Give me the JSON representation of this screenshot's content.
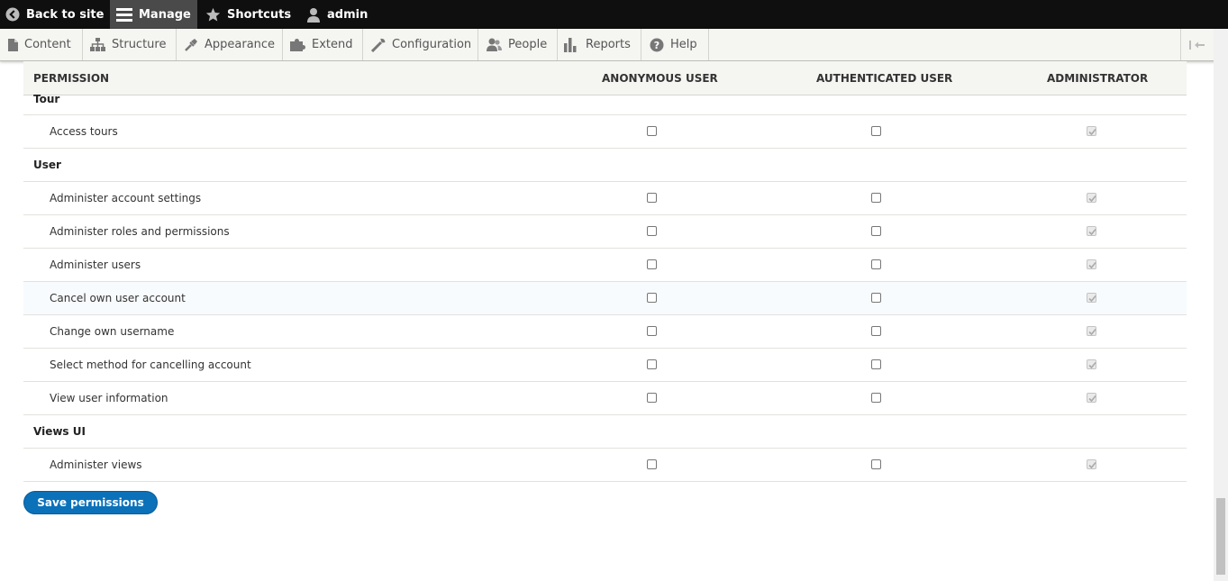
{
  "toolbar": {
    "back": "Back to site",
    "manage": "Manage",
    "shortcuts": "Shortcuts",
    "user": "admin"
  },
  "tray": {
    "items": [
      "Content",
      "Structure",
      "Appearance",
      "Extend",
      "Configuration",
      "People",
      "Reports",
      "Help"
    ]
  },
  "table": {
    "headers": {
      "permission": "PERMISSION",
      "anonymous": "ANONYMOUS USER",
      "authenticated": "AUTHENTICATED USER",
      "administrator": "ADMINISTRATOR"
    },
    "rows": [
      {
        "type": "module",
        "label": "Tour"
      },
      {
        "type": "perm",
        "label": "Access tours",
        "anonymous": false,
        "authenticated": false,
        "administrator": true
      },
      {
        "type": "module",
        "label": "User"
      },
      {
        "type": "perm",
        "label": "Administer account settings",
        "anonymous": false,
        "authenticated": false,
        "administrator": true
      },
      {
        "type": "perm",
        "label": "Administer roles and permissions",
        "anonymous": false,
        "authenticated": false,
        "administrator": true
      },
      {
        "type": "perm",
        "label": "Administer users",
        "anonymous": false,
        "authenticated": false,
        "administrator": true
      },
      {
        "type": "perm",
        "label": "Cancel own user account",
        "anonymous": false,
        "authenticated": false,
        "administrator": true
      },
      {
        "type": "perm",
        "label": "Change own username",
        "anonymous": false,
        "authenticated": false,
        "administrator": true
      },
      {
        "type": "perm",
        "label": "Select method for cancelling account",
        "anonymous": false,
        "authenticated": false,
        "administrator": true
      },
      {
        "type": "perm",
        "label": "View user information",
        "anonymous": false,
        "authenticated": false,
        "administrator": true
      },
      {
        "type": "module",
        "label": "Views UI"
      },
      {
        "type": "perm",
        "label": "Administer views",
        "anonymous": false,
        "authenticated": false,
        "administrator": true
      }
    ]
  },
  "save_label": "Save permissions",
  "colors": {
    "toolbar_bg": "#0f0f0f",
    "tray_bg": "#f5f5f2",
    "button_bg": "#0b71b9"
  }
}
